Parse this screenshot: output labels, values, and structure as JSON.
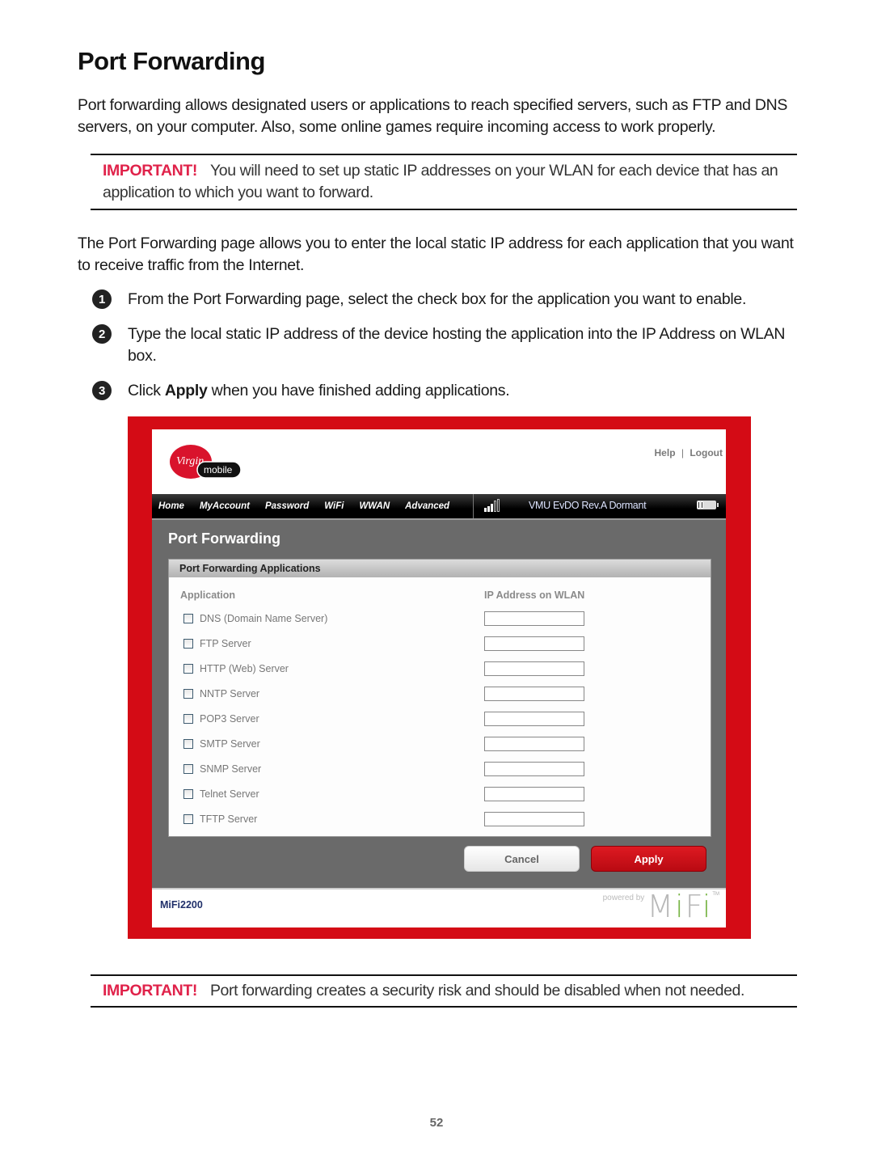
{
  "document": {
    "title": "Port Forwarding",
    "intro": "Port forwarding allows designated users or applications to reach specified servers, such as FTP and DNS servers, on your computer. Also, some online games require incoming access to work properly.",
    "note1": {
      "label": "IMPORTANT!",
      "text": "You will need to set up static IP addresses on your WLAN for each device that has an application to which you want to forward."
    },
    "description": "The Port Forwarding page allows you to enter the local static IP address for each application that you want to receive traffic from the Internet.",
    "steps": [
      {
        "num": "1",
        "text": "From the Port Forwarding page, select the check box for the application you want to enable."
      },
      {
        "num": "2",
        "text": "Type the local static IP address of the device hosting the application into the IP Address on WLAN box."
      },
      {
        "num": "3",
        "text_before": "Click",
        "bold": "Apply",
        "text_after": "when you have finished adding applications."
      }
    ],
    "note2": {
      "label": "IMPORTANT!",
      "text": "Port forwarding creates a security risk and should be disabled when not needed."
    },
    "page_number": "52"
  },
  "screenshot": {
    "logo": {
      "brand": "Virgin",
      "sub": "mobile"
    },
    "header_links": {
      "help": "Help",
      "separator": "|",
      "logout": "Logout"
    },
    "nav": [
      "Home",
      "MyAccount",
      "Password",
      "WiFi",
      "WWAN",
      "Advanced"
    ],
    "status": {
      "signal_bars": 3,
      "signal_max": 5,
      "text": "VMU  EvDO Rev.A  Dormant",
      "battery_level": 0.5
    },
    "page_heading": "Port Forwarding",
    "panel_title": "Port Forwarding Applications",
    "columns": {
      "application": "Application",
      "ip": "IP Address on WLAN"
    },
    "applications": [
      {
        "label": "DNS (Domain Name Server)",
        "checked": false,
        "ip": ""
      },
      {
        "label": "FTP Server",
        "checked": false,
        "ip": ""
      },
      {
        "label": "HTTP (Web) Server",
        "checked": false,
        "ip": ""
      },
      {
        "label": "NNTP Server",
        "checked": false,
        "ip": ""
      },
      {
        "label": "POP3 Server",
        "checked": false,
        "ip": ""
      },
      {
        "label": "SMTP Server",
        "checked": false,
        "ip": ""
      },
      {
        "label": "SNMP Server",
        "checked": false,
        "ip": ""
      },
      {
        "label": "Telnet Server",
        "checked": false,
        "ip": ""
      },
      {
        "label": "TFTP Server",
        "checked": false,
        "ip": ""
      }
    ],
    "buttons": {
      "cancel": "Cancel",
      "apply": "Apply"
    },
    "footer": {
      "model": "MiFi2200",
      "powered_by": "powered by",
      "brand_m": "M",
      "brand_i": "i",
      "brand_f": "F",
      "brand_i2": "i",
      "tm": "TM"
    },
    "colors": {
      "frame": "#d40b15",
      "accent_important": "#e0224a",
      "apply": "#c8101a"
    }
  }
}
